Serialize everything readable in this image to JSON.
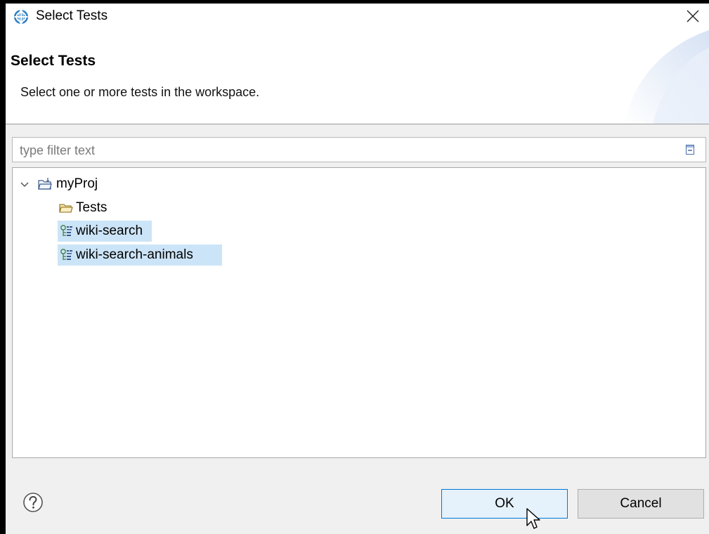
{
  "window": {
    "title": "Select Tests",
    "app_icon": "eclipse-globe-icon",
    "close_icon": "close-icon"
  },
  "banner": {
    "title": "Select Tests",
    "description": "Select one or more tests in the workspace."
  },
  "filter": {
    "placeholder": "type filter text",
    "value": "",
    "clear_icon": "collapse-all-icon"
  },
  "tree": {
    "items": [
      {
        "label": "myProj",
        "icon": "java-project-folder-icon",
        "expanded": true,
        "selected": false,
        "level": 0
      },
      {
        "label": "Tests",
        "icon": "folder-icon",
        "selected": false,
        "level": 1
      },
      {
        "label": "wiki-search",
        "icon": "test-file-icon",
        "selected": true,
        "level": 1
      },
      {
        "label": "wiki-search-animals",
        "icon": "test-file-icon",
        "selected": true,
        "level": 1
      }
    ]
  },
  "footer": {
    "help_icon": "help-icon",
    "ok_label": "OK",
    "cancel_label": "Cancel"
  },
  "colors": {
    "selection": "#cce4f7",
    "ok_border": "#0078d7",
    "dialog_bg": "#f0f0f0"
  }
}
